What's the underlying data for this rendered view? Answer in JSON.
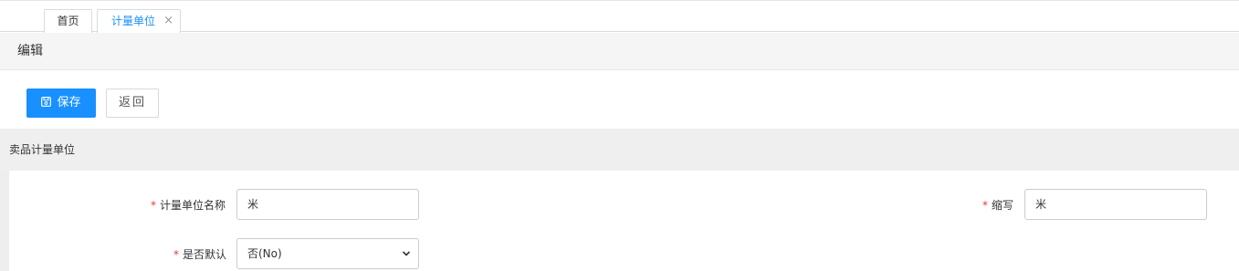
{
  "tabs": {
    "home_label": "首页",
    "active_label": "计量单位",
    "close_glyph": "×"
  },
  "section": {
    "title": "编辑"
  },
  "toolbar": {
    "save_label": "保存",
    "back_label": "返回"
  },
  "form": {
    "title": "卖品计量单位",
    "required_mark": "*",
    "name_label": "计量单位名称",
    "name_value": "米",
    "abbr_label": "缩写",
    "abbr_value": "米",
    "default_label": "是否默认",
    "default_value": "否(No)"
  },
  "colors": {
    "accent": "#1890ff",
    "required": "#e4393c"
  }
}
